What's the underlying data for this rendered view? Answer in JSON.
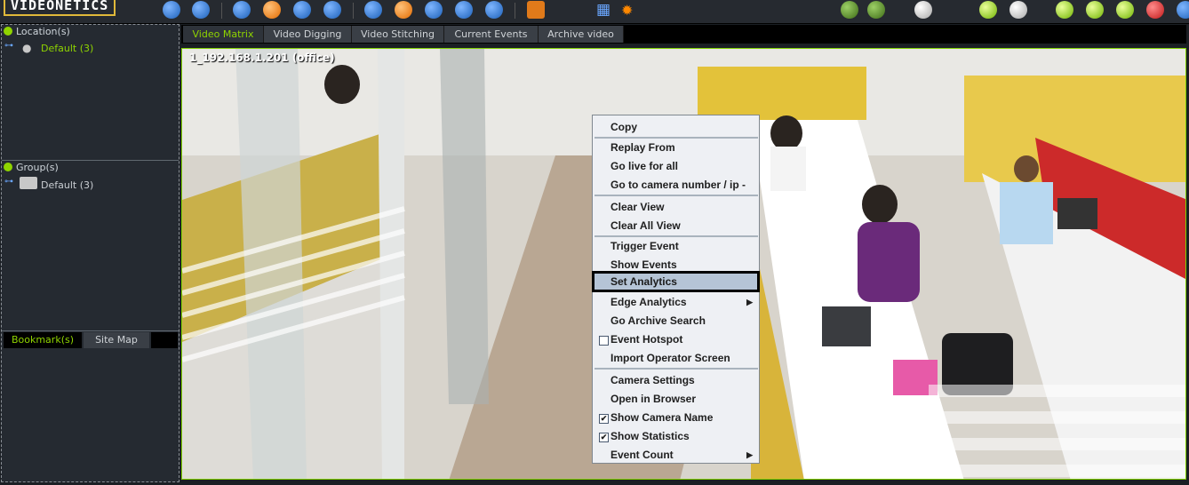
{
  "app": {
    "logo": "VIDEONETICS"
  },
  "left_panel": {
    "location_header": "Location(s)",
    "location_item": "Default (3)",
    "group_header": "Group(s)",
    "group_item": "Default (3)",
    "bookmark_tabs": [
      "Bookmark(s)",
      "Site Map"
    ]
  },
  "view_tabs": [
    "Video Matrix",
    "Video Digging",
    "Video Stitching",
    "Current Events",
    "Archive video"
  ],
  "camera": {
    "label": "1_192.168.1.201 (office)"
  },
  "context_menu": {
    "items": [
      "Copy",
      "Replay From",
      "Go live for all",
      "Go to camera number / ip -",
      "Clear View",
      "Clear All View",
      "Trigger Event",
      "Show Events",
      "Set Analytics",
      "Edge Analytics",
      "Go Archive Search",
      "Event Hotspot",
      "Import Operator Screen",
      "Camera Settings",
      "Open in Browser",
      "Show Camera Name",
      "Show Statistics",
      "Event Count"
    ],
    "highlighted": "Set Analytics",
    "checked": [
      "Show Camera Name",
      "Show Statistics"
    ],
    "submenu": [
      "Edge Analytics",
      "Event Count"
    ]
  },
  "colors": {
    "accent_green": "#8fd400",
    "menu_bg": "#eef0f4",
    "highlight": "#b5c4d6"
  }
}
